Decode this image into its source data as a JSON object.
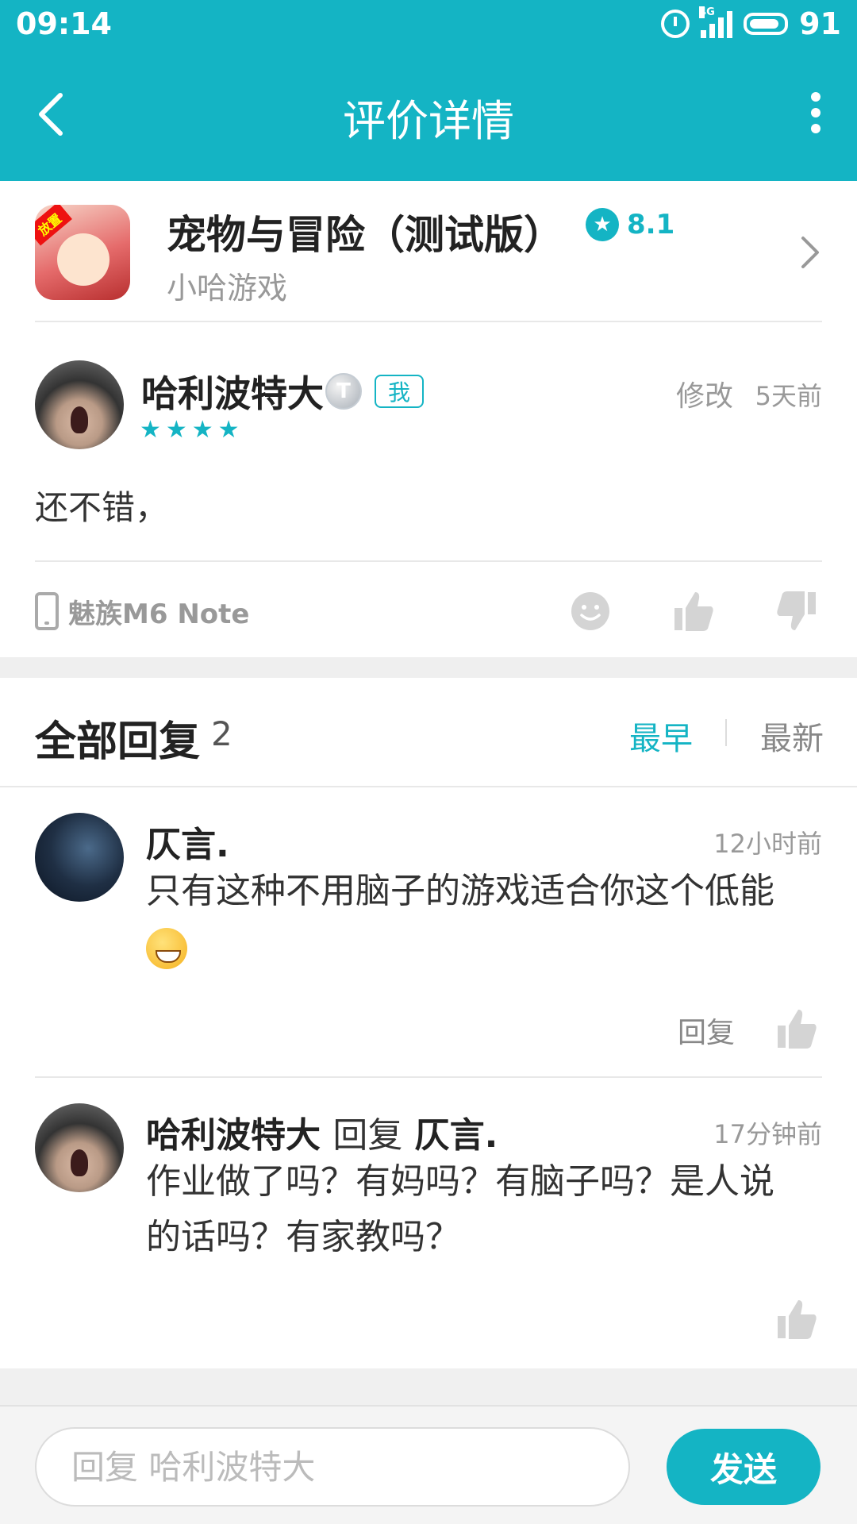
{
  "status_bar": {
    "time": "09:14",
    "network": "4G",
    "battery": "91"
  },
  "header": {
    "title": "评价详情"
  },
  "app": {
    "name": "宠物与冒险（测试版）",
    "rating": "8.1",
    "developer": "小哈游戏",
    "icon_tag": "放置"
  },
  "review": {
    "author": "哈利波特大",
    "level_badge": "T",
    "me_badge": "我",
    "stars": "★★★★",
    "star_count": 4,
    "edit_label": "修改",
    "time": "5天前",
    "content": "还不错，",
    "device": "魅族M6 Note"
  },
  "replies": {
    "title": "全部回复",
    "count": "2",
    "sort_earliest": "最早",
    "sort_latest": "最新",
    "items": [
      {
        "author": "仄言.",
        "time": "12小时前",
        "text": "只有这种不用脑子的游戏适合你这个低能",
        "emoji": "grinning-face",
        "reply_label": "回复"
      },
      {
        "author": "哈利波特大",
        "reply_word": "回复",
        "reply_to": "仄言.",
        "time": "17分钟前",
        "text": "作业做了吗？有妈吗？有脑子吗？是人说的话吗？有家教吗？"
      }
    ]
  },
  "composer": {
    "placeholder": "回复 哈利波特大",
    "send_label": "发送"
  },
  "colors": {
    "accent": "#14b4c4",
    "muted_text": "#999999",
    "background_band": "#efefef"
  }
}
